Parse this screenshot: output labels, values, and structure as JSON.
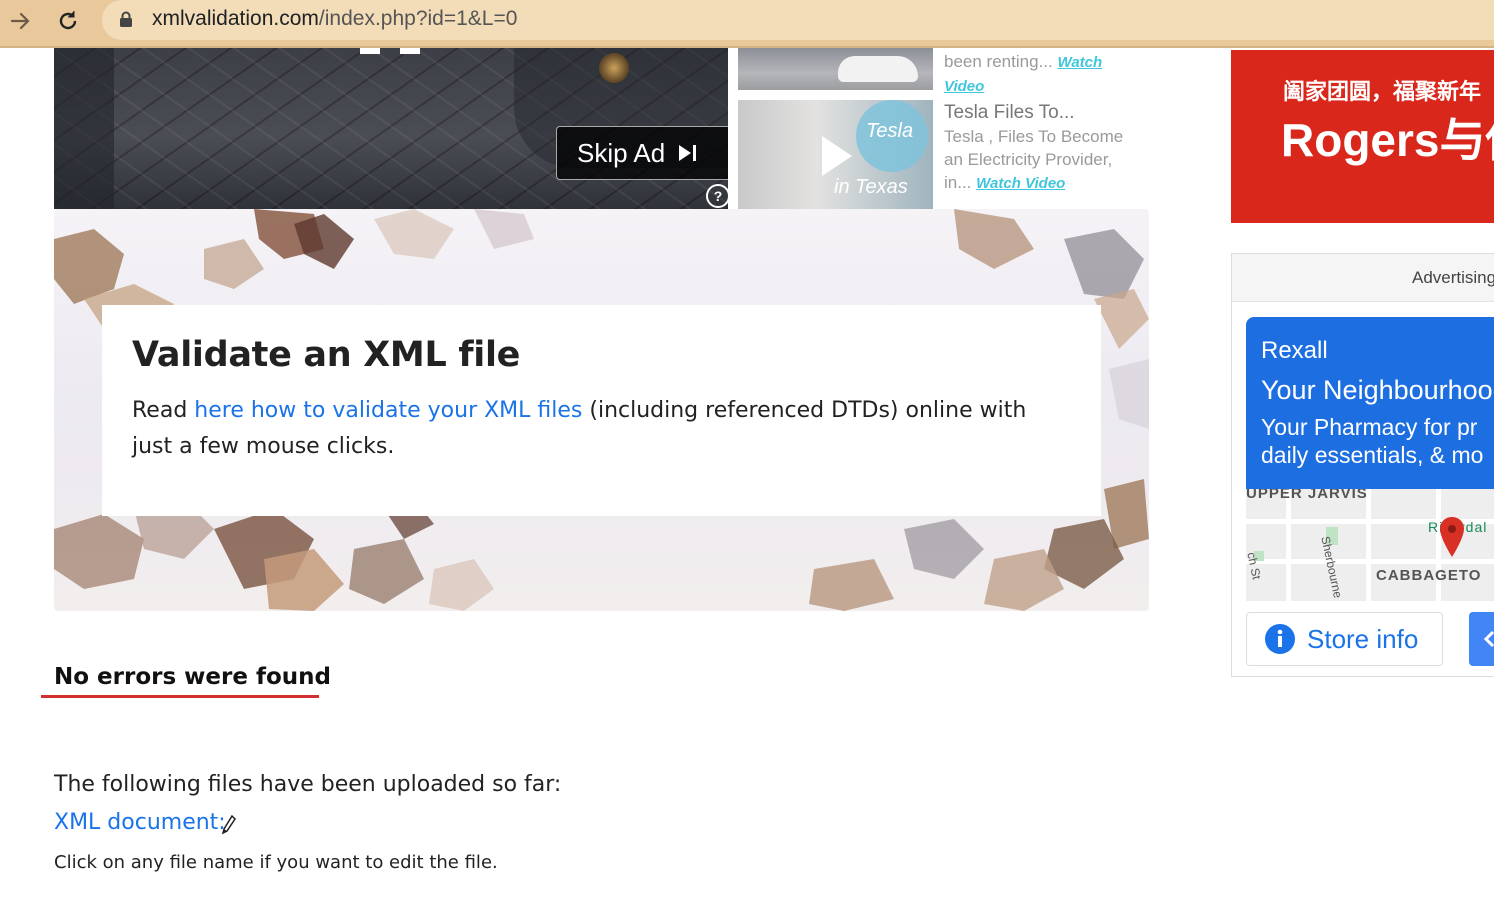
{
  "browser": {
    "url_host": "xmlvalidation.com",
    "url_path": "/index.php?id=1&L=0",
    "forward_icon": "arrow-right-icon",
    "reload_icon": "reload-icon",
    "lock_icon": "lock-icon"
  },
  "video_ad": {
    "skip_label": "Skip Ad",
    "help_label": "?"
  },
  "related_videos": [
    {
      "snippet": "been renting...",
      "watch_label": "Watch Video"
    },
    {
      "title": "Tesla Files To...",
      "snippet": "Tesla , Files To Become an Electricity Provider, in...",
      "watch_label": "Watch Video",
      "thumb_text_top": "Tesla",
      "thumb_text_bottom": "in Texas"
    }
  ],
  "hero": {
    "title": "Validate an XML file",
    "text_before": "Read ",
    "link_text": "here how to validate your XML files",
    "text_after": " (including referenced DTDs) online with just a few mouse clicks."
  },
  "result": {
    "status": "No errors were found",
    "uploaded_heading": "The following files have been uploaded so far:",
    "file_link": "XML document:",
    "edit_icon": "pencil-icon",
    "hint": "Click on any file name if you want to edit the file."
  },
  "ads": {
    "red_ad_chinese": "阖家团圆，福聚新年",
    "red_ad_brand": "Rogers与你",
    "advertising_label": "Advertising",
    "rexall": {
      "brand": "Rexall",
      "headline": "Your Neighbourhood",
      "sub_line1": "Your Pharmacy for pr",
      "sub_line2": "daily essentials, & mo"
    },
    "map": {
      "label_upper_jarvis": "UPPER JARVIS",
      "label_cabbagetown": "CABBAGETO",
      "label_sherbourne": "Sherbourne St",
      "label_riverdale": "Riverdal",
      "label_jarvis_st": "ch St"
    },
    "store_info_label": "Store info"
  },
  "colors": {
    "accent_link": "#1a73e8",
    "error_underline": "#d32f2f",
    "red_ad": "#d9271c",
    "rexall_blue": "#1d6ee0"
  }
}
